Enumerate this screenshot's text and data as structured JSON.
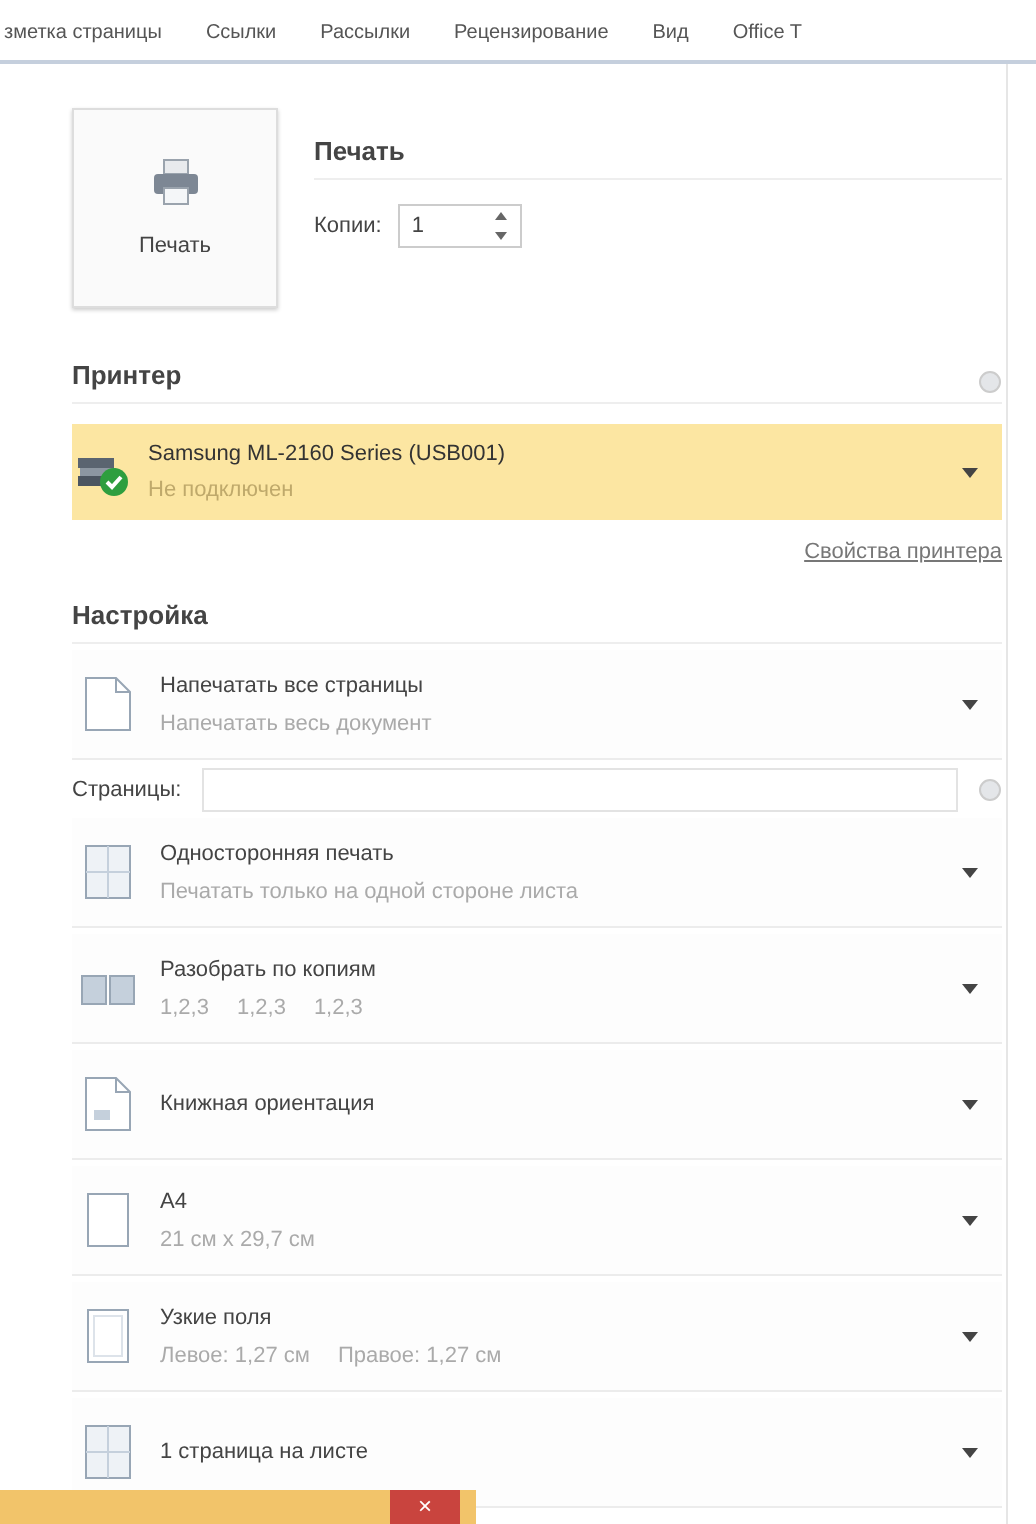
{
  "ribbon_tabs": [
    {
      "label": "зметка страницы"
    },
    {
      "label": "Ссылки"
    },
    {
      "label": "Рассылки"
    },
    {
      "label": "Рецензирование"
    },
    {
      "label": "Вид"
    },
    {
      "label": "Office T"
    }
  ],
  "print": {
    "button": "Печать",
    "heading": "Печать",
    "copies_label": "Копии:",
    "copies_value": "1"
  },
  "printer": {
    "heading": "Принтер",
    "name": "Samsung ML-2160 Series (USB001)",
    "status": "Не подключен",
    "properties_link": "Свойства принтера"
  },
  "settings": {
    "heading": "Настройка",
    "pages_label": "Страницы:",
    "items": [
      {
        "kind": "pages",
        "title": "Напечатать все страницы",
        "details": [
          "Напечатать весь документ"
        ]
      },
      {
        "kind": "duplex",
        "title": "Односторонняя печать",
        "details": [
          "Печатать только на одной стороне листа"
        ]
      },
      {
        "kind": "collate",
        "title": "Разобрать по копиям",
        "details": [
          "1,2,3",
          "1,2,3",
          "1,2,3"
        ]
      },
      {
        "kind": "orientation",
        "title": "Книжная ориентация"
      },
      {
        "kind": "paper",
        "title": "A4",
        "details": [
          "21 см x 29,7 см"
        ]
      },
      {
        "kind": "margins",
        "title": "Узкие поля",
        "details": [
          "Левое: 1,27 см",
          "Правое: 1,27 см"
        ]
      },
      {
        "kind": "per-sheet",
        "title": "1 страница на листе"
      }
    ]
  },
  "notification_bar": {
    "close": "×"
  }
}
